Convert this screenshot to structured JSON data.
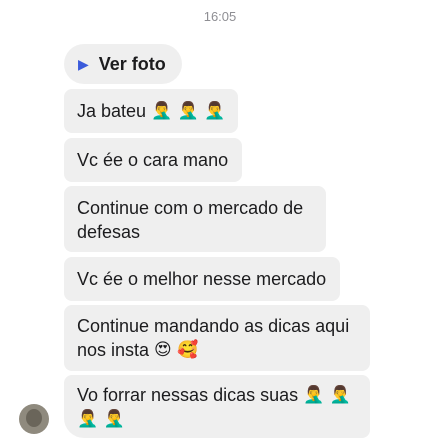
{
  "timestamp": "16:05",
  "messages": [
    {
      "id": "m1",
      "text": "Ver foto",
      "icon": "play-icon"
    },
    {
      "id": "m2",
      "text": "Ja bateu",
      "emoji": "🤦‍♂️ 🤦‍♂️ 🤦‍♂️"
    },
    {
      "id": "m3",
      "text": "Vc ée o cara mano"
    },
    {
      "id": "m4",
      "line1": "Continue com o mercado de",
      "line2": "defesas"
    },
    {
      "id": "m5",
      "text": "Vc ée o melhor nesse mercado"
    },
    {
      "id": "m6",
      "line1": "Continue mandando as dicas aqui",
      "line2": "nos insta",
      "emoji": "😍 🥰"
    },
    {
      "id": "m7",
      "line1": "Vo forrar nessas dicas suas",
      "emoji1": "🤦‍♂️ 🤦‍♂️",
      "emoji2": "🤦‍♂️ 🤦‍♂️"
    }
  ],
  "colors": {
    "bubble": "#efefef",
    "text": "#1c1c1e",
    "play_icon": "#3b5bdb"
  }
}
